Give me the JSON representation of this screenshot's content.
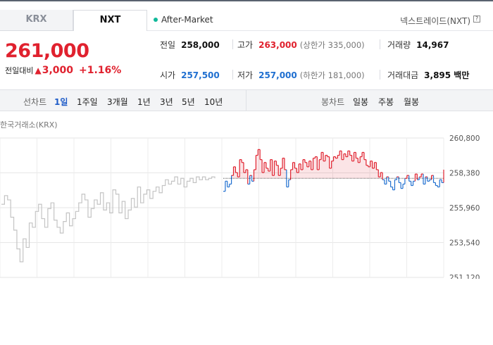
{
  "tabs": [
    {
      "label": "KRX",
      "active": false
    },
    {
      "label": "NXT",
      "active": true
    }
  ],
  "session": {
    "label": "After-Market",
    "color": "#10b99a"
  },
  "venue": {
    "label": "넥스트레이드(NXT)",
    "help_icon": "question-icon"
  },
  "quote": {
    "price": "261,000",
    "change_label": "전일대비",
    "change_icon": "up-triangle-icon",
    "change_value": "3,000",
    "change_pct": "+1.16%"
  },
  "stats": {
    "prev_close": {
      "label": "전일",
      "value": "258,000"
    },
    "high": {
      "label": "고가",
      "value": "263,000",
      "sub": "(상한가 335,000)"
    },
    "volume": {
      "label": "거래량",
      "value": "14,967"
    },
    "open": {
      "label": "시가",
      "value": "257,500"
    },
    "low": {
      "label": "저가",
      "value": "257,000",
      "sub": "(하한가 181,000)"
    },
    "amount": {
      "label": "거래대금",
      "value": "3,895 백만"
    }
  },
  "period_bar": {
    "line_label": "선차트",
    "line_periods": [
      "1일",
      "1주일",
      "3개월",
      "1년",
      "3년",
      "5년",
      "10년"
    ],
    "selected": "1일",
    "candle_label": "봉차트",
    "candle_periods": [
      "일봉",
      "주봉",
      "월봉"
    ]
  },
  "chart_meta": {
    "market_label": "한국거래소(KRX)"
  },
  "colors": {
    "up": "#e0212e",
    "down": "#1f6fd0",
    "krx": "#c4c4c4",
    "ref": "#555555"
  },
  "chart_data": {
    "type": "line",
    "ylim": [
      251120,
      260800
    ],
    "y_ticks": [
      "260,800",
      "258,380",
      "255,960",
      "253,540",
      "251,120"
    ],
    "reference": 258000,
    "grid": true,
    "series": [
      {
        "name": "한국거래소(KRX)",
        "values": [
          256200,
          256800,
          256500,
          255300,
          254400,
          253100,
          252200,
          253800,
          253200,
          254900,
          254600,
          255700,
          256200,
          255200,
          254600,
          255900,
          256300,
          255100,
          254600,
          254200,
          255000,
          255600,
          254700,
          255200,
          255700,
          256300,
          256900,
          256500,
          255300,
          255900,
          256500,
          256200,
          257000,
          255800,
          256300,
          255600,
          257200,
          256900,
          255600,
          256400,
          255200,
          255800,
          256600,
          256000,
          257400,
          256300,
          256900,
          257200,
          256600,
          257100,
          257400,
          257000,
          257500,
          257900,
          257600,
          257800,
          258100,
          257600,
          258000,
          257400,
          257800,
          258000,
          257700,
          258100,
          257900,
          258100,
          257900,
          258000,
          258100,
          258000
        ]
      },
      {
        "name": "넥스트레이드(NXT)",
        "values": [
          257100,
          257800,
          257400,
          257600,
          258200,
          258800,
          258400,
          258100,
          259300,
          259100,
          258400,
          258600,
          257600,
          258200,
          257800,
          258600,
          259600,
          260000,
          259300,
          258400,
          259100,
          258700,
          258500,
          259300,
          258200,
          259200,
          258900,
          258200,
          258700,
          259400,
          258600,
          257400,
          257900,
          258600,
          259100,
          258700,
          258400,
          259000,
          258600,
          259300,
          259100,
          258800,
          259200,
          258600,
          259400,
          259500,
          258600,
          259300,
          259800,
          259200,
          259600,
          259500,
          258700,
          259200,
          259500,
          259400,
          259600,
          259900,
          259300,
          259700,
          259500,
          259900,
          259600,
          259200,
          259800,
          259400,
          259100,
          259500,
          259800,
          259300,
          258900,
          258800,
          259200,
          258700,
          259100,
          258600,
          258100,
          258400,
          257900,
          257600,
          258100,
          257800,
          257400,
          257200,
          257900,
          258100,
          257700,
          257300,
          257600,
          258000,
          258200,
          257800,
          257500,
          257800,
          258300,
          257900,
          258100,
          258300,
          257600,
          258100,
          257800,
          257900,
          258200,
          257700,
          257500,
          257400,
          257900,
          257700,
          258600
        ]
      }
    ]
  }
}
